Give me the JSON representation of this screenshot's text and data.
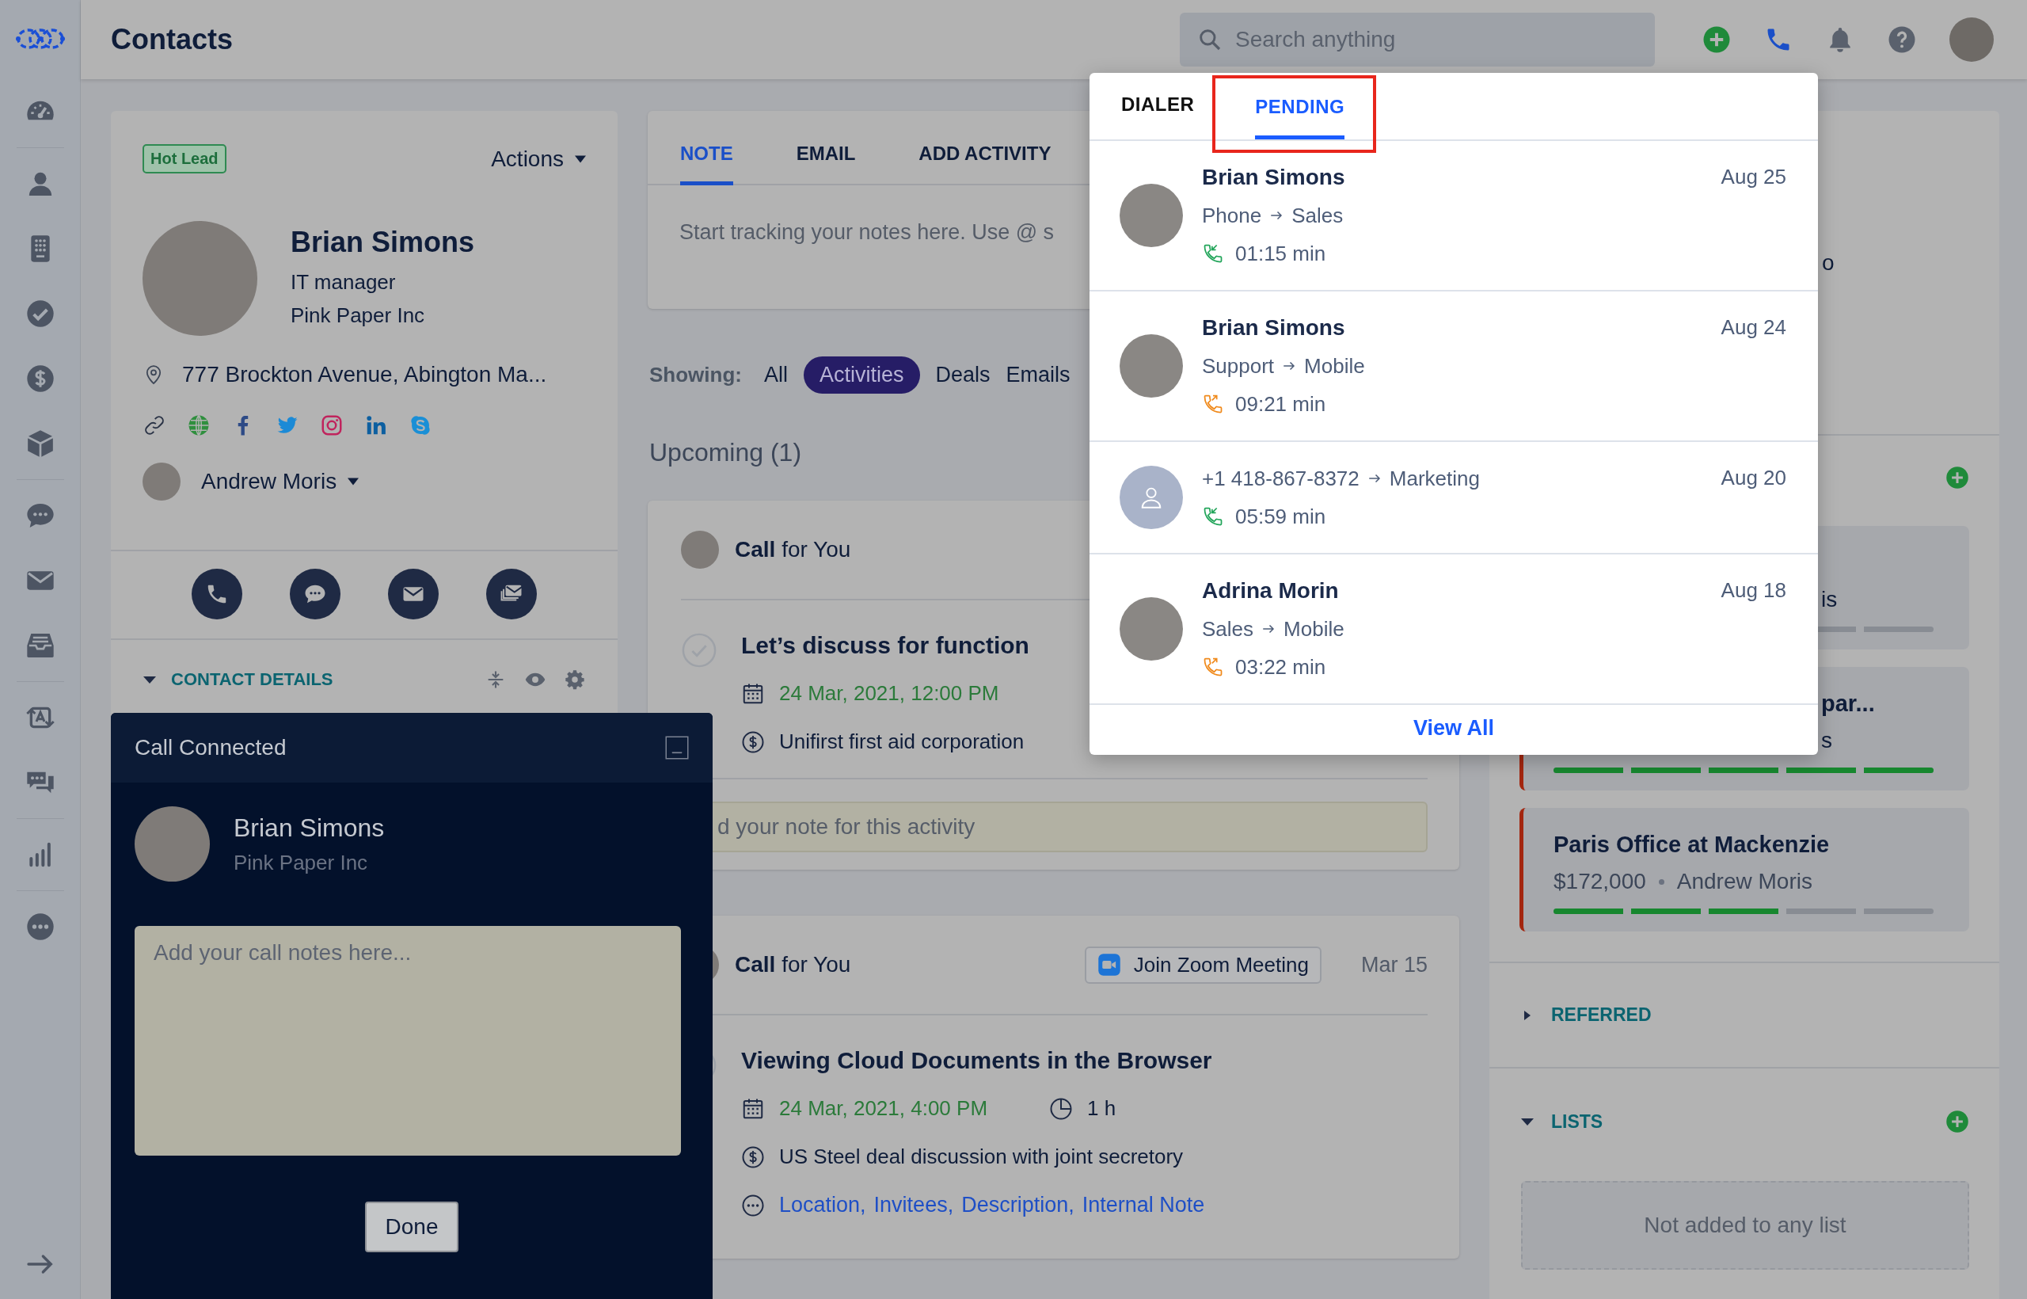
{
  "header": {
    "title": "Contacts",
    "search": {
      "placeholder": "Search anything"
    },
    "actions": [
      {
        "kind": "add",
        "selected": false
      },
      {
        "kind": "phone",
        "selected": true
      },
      {
        "kind": "bell",
        "selected": false
      },
      {
        "kind": "help",
        "selected": false
      }
    ]
  },
  "contact": {
    "badge": "Hot Lead",
    "actions_label": "Actions",
    "name": "Brian Simons",
    "job_title": "IT manager",
    "company": "Pink Paper Inc",
    "address": "777 Brockton Avenue, Abington Ma...",
    "owner": "Andrew Moris",
    "details_section": {
      "title": "CONTACT DETAILS",
      "expanded": true
    }
  },
  "note_card": {
    "tabs": [
      {
        "label": "NOTE",
        "selected": true
      },
      {
        "label": "EMAIL",
        "selected": false
      },
      {
        "label": "ADD ACTIVITY",
        "selected": false
      }
    ],
    "placeholder": "Start tracking your notes here. Use @ s"
  },
  "filter": {
    "label": "Showing:",
    "options": [
      {
        "label": "All",
        "selected": false
      },
      {
        "label": "Activities",
        "selected": true
      },
      {
        "label": "Deals",
        "selected": false
      },
      {
        "label": "Emails",
        "selected": false
      }
    ]
  },
  "upcoming_title": "Upcoming (1)",
  "activities": [
    {
      "heading": "**Call** for You",
      "title": "Let’s discuss for function",
      "date": "24 Mar, 2021, 12:00 PM",
      "deal": "Unifirst first aid corporation",
      "note_placeholder": "d your note for this activity"
    },
    {
      "heading": "**Call** for You",
      "zoom_label": "Join Zoom Meeting",
      "short_date": "Mar 15",
      "title": "Viewing Cloud Documents in the Browser",
      "date": "24 Mar, 2021, 4:00 PM",
      "duration": "1 h",
      "deal": "US Steel deal discussion with joint secretory",
      "links": [
        "Location,",
        "Invitees,",
        "Description,",
        "Internal Note"
      ]
    }
  ],
  "right": {
    "fragment": "o",
    "deals": [
      {
        "subtitle": "is",
        "level": 0.6
      },
      {
        "title": "par...",
        "subtitle": "s",
        "level": 1
      },
      {
        "title": "Paris Office at Mackenzie",
        "value": "$172,000",
        "owner": "Andrew Moris",
        "level": 0.6
      }
    ],
    "sections": [
      {
        "title": "REFERRED",
        "expanded": false
      },
      {
        "title": "LISTS",
        "expanded": true,
        "empty_text": "Not added to any list"
      }
    ]
  },
  "call_dropdown": {
    "tabs": [
      {
        "label": "DIALER",
        "selected": false,
        "highlighted": false
      },
      {
        "label": "PENDING",
        "selected": true,
        "highlighted": true
      }
    ],
    "calls": [
      {
        "kind": "incoming",
        "name": "Brian Simons",
        "from": "Phone",
        "to": "Sales",
        "duration": "01:15 min",
        "date": "Aug 25"
      },
      {
        "kind": "outgoing",
        "name": "Brian Simons",
        "from": "Support",
        "to": "Mobile",
        "duration": "09:21 min",
        "date": "Aug 24"
      },
      {
        "kind": "incoming",
        "from": "+1 418-867-8372",
        "to": "Marketing",
        "duration": "05:59 min",
        "date": "Aug 20"
      },
      {
        "kind": "outgoing",
        "name": "Adrina Morin",
        "from": "Sales",
        "to": "Mobile",
        "duration": "03:22 min",
        "date": "Aug 18"
      }
    ],
    "view_all": "View All"
  },
  "call_panel": {
    "title": "Call Connected",
    "name": "Brian Simons",
    "company": "Pink Paper Inc",
    "notes_placeholder": "Add your call notes here...",
    "done_label": "Done"
  }
}
